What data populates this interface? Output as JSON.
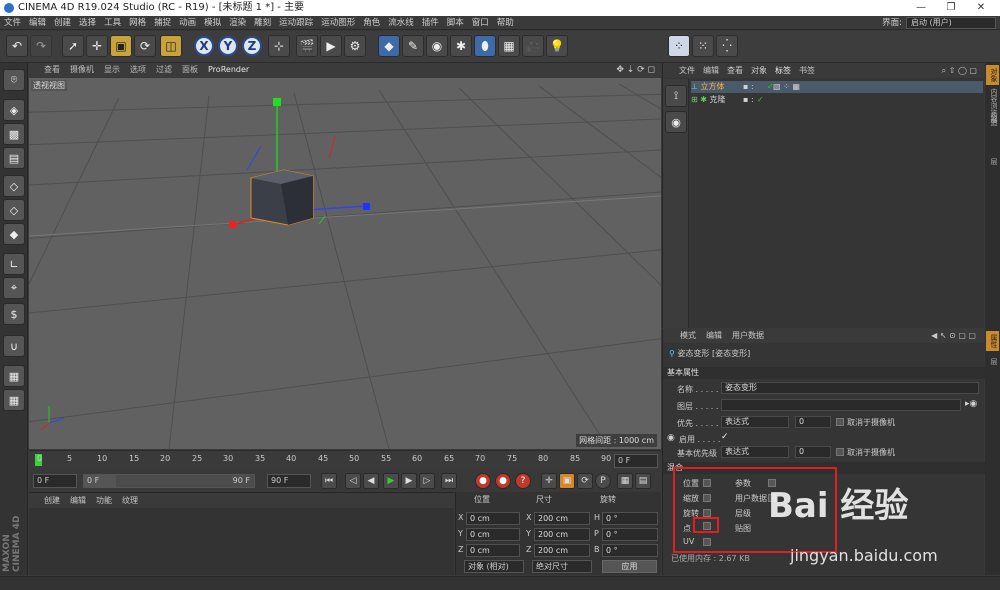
{
  "window": {
    "title": "CINEMA 4D R19.024 Studio (RC - R19) - [未标题 1 *] - 主要",
    "minimize": "—",
    "maximize": "❐",
    "close": "✕"
  },
  "menu": [
    "文件",
    "编辑",
    "创建",
    "选择",
    "工具",
    "网格",
    "捕捉",
    "动画",
    "模拟",
    "渲染",
    "雕刻",
    "运动跟踪",
    "运动图形",
    "角色",
    "流水线",
    "插件",
    "脚本",
    "窗口",
    "帮助"
  ],
  "layout": {
    "label": "界面:",
    "value": "启动 (用户)"
  },
  "viewport": {
    "menu": [
      "查看",
      "摄像机",
      "显示",
      "选项",
      "过滤",
      "面板",
      "ProRender"
    ],
    "label": "透视视图",
    "grid_info": "网格间距 : 1000 cm"
  },
  "timeline": {
    "ticks": [
      "0",
      "5",
      "10",
      "15",
      "20",
      "25",
      "30",
      "35",
      "40",
      "45",
      "50",
      "55",
      "60",
      "65",
      "70",
      "75",
      "80",
      "85",
      "90"
    ],
    "end_field": "0 F"
  },
  "transport": {
    "start": "0 F",
    "range_start": "0 F",
    "range_end": "90 F",
    "end": "90 F"
  },
  "material": {
    "menu": [
      "创建",
      "编辑",
      "功能",
      "纹理"
    ]
  },
  "coords": {
    "headers": [
      "位置",
      "尺寸",
      "旋转"
    ],
    "rows": [
      {
        "axis": "X",
        "pos": "0 cm",
        "size_axis": "X",
        "size": "200 cm",
        "rot_axis": "H",
        "rot": "0 °"
      },
      {
        "axis": "Y",
        "pos": "0 cm",
        "size_axis": "Y",
        "size": "200 cm",
        "rot_axis": "P",
        "rot": "0 °"
      },
      {
        "axis": "Z",
        "pos": "0 cm",
        "size_axis": "Z",
        "size": "200 cm",
        "rot_axis": "B",
        "rot": "0 °"
      }
    ],
    "mode": "对象 (相对)",
    "size_mode": "绝对尺寸",
    "apply": "应用"
  },
  "maxon": "MAXON CINEMA 4D",
  "objects": {
    "menu": [
      "文件",
      "编辑",
      "查看",
      "对象",
      "标签",
      "书签"
    ],
    "items": [
      {
        "name": "立方体",
        "check": "✓"
      },
      {
        "name": "克隆",
        "check": "✓"
      }
    ]
  },
  "sidetabs": [
    "对象",
    "内容浏览器",
    "构造",
    "层",
    "属性",
    "层"
  ],
  "attributes": {
    "menu": [
      "模式",
      "编辑",
      "用户数据"
    ],
    "object_title": "姿态变形 [姿态变形]",
    "section_basic": "基本属性",
    "name_label": "名称 . . . . .",
    "name_value": "姿态变形",
    "layer_label": "图层 . . . . .",
    "priority_label": "优先 . . . . .",
    "priority_value": "表达式",
    "priority_num": "0",
    "camera_dep": "取消于摄像机",
    "enable_label": "启用 . . . . .",
    "enable_check": "✓",
    "base_priority_label": "基本优先级",
    "base_priority_value": "表达式",
    "base_priority_num": "0",
    "camera_dep2": "取消于摄像机",
    "section_mix": "混合",
    "mix_left": [
      "位置",
      "缩放",
      "旋转",
      "点",
      "UV"
    ],
    "mix_right": [
      "参数",
      "用户数据",
      "层级",
      "贴图"
    ],
    "memory": "已使用内存 : 2.67 KB"
  },
  "watermark": {
    "brand": "Bai 经验",
    "url": "jingyan.baidu.com"
  },
  "colors": {
    "accent": "#c98b2c",
    "highlight": "#e02020",
    "selection": "#3d6aa8"
  }
}
